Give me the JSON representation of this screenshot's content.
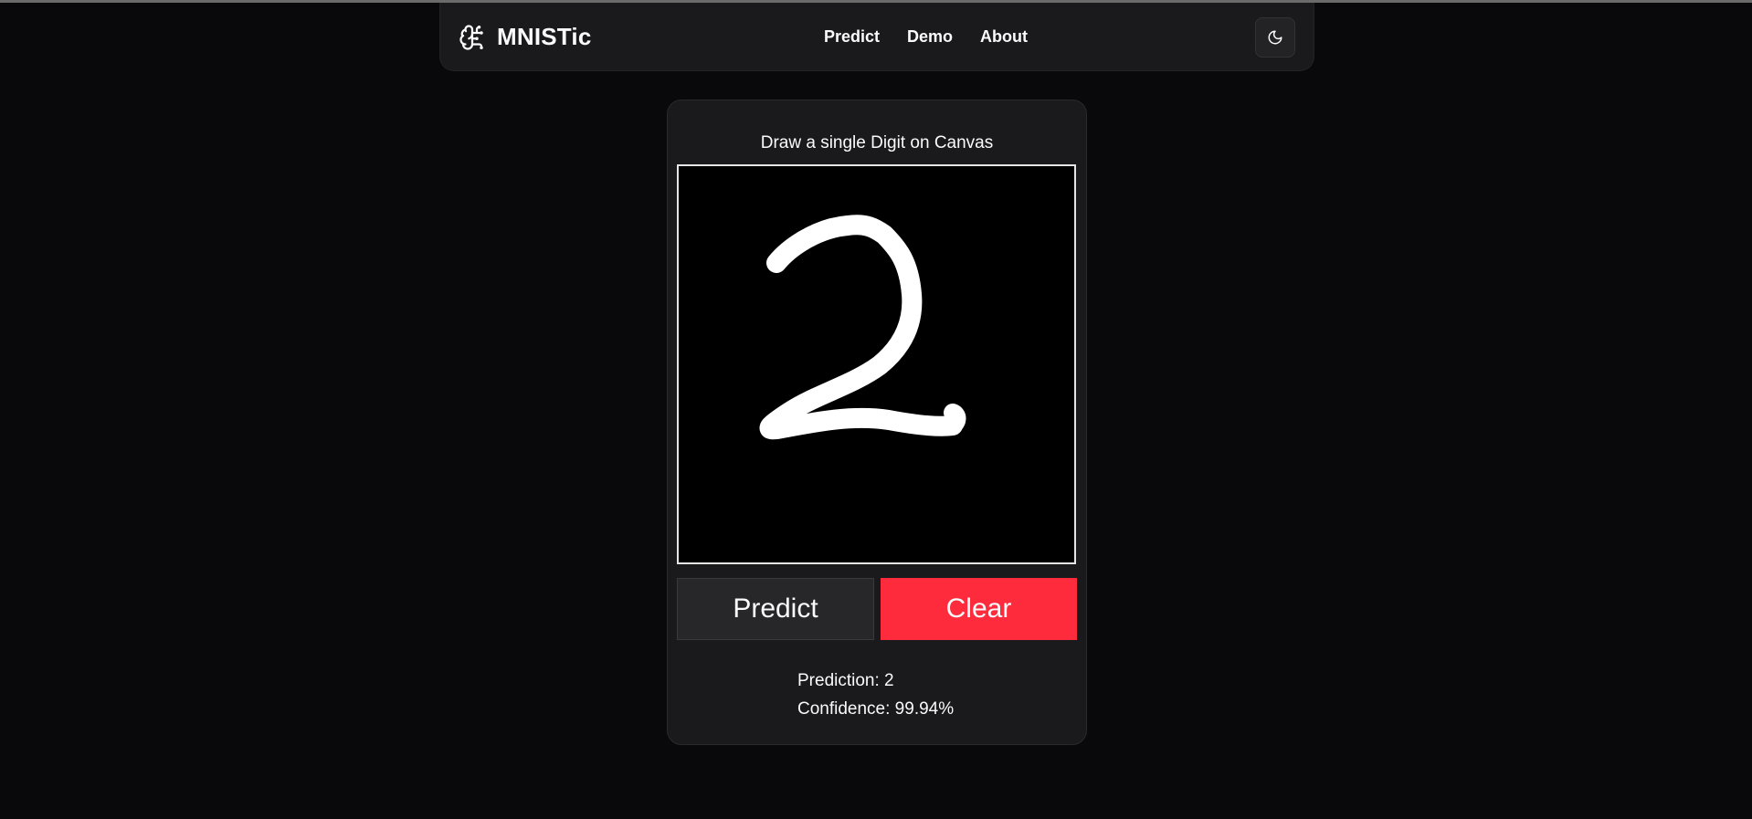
{
  "app": {
    "brand_name": "MNISTic",
    "brand_icon": "brain-icon"
  },
  "nav": {
    "links": [
      {
        "label": "Predict"
      },
      {
        "label": "Demo"
      },
      {
        "label": "About"
      }
    ],
    "theme_toggle_icon": "moon-icon"
  },
  "card": {
    "instruction": "Draw a single Digit on Canvas",
    "canvas_content": "handwritten digit 2",
    "predict_label": "Predict",
    "clear_label": "Clear",
    "prediction_text": "Prediction: 2",
    "confidence_text": "Confidence: 99.94%"
  },
  "colors": {
    "background": "#09090b",
    "surface": "#1a1a1d",
    "clear_button": "#fe2b3c",
    "predict_button": "#27272a",
    "text": "#fafafa"
  }
}
